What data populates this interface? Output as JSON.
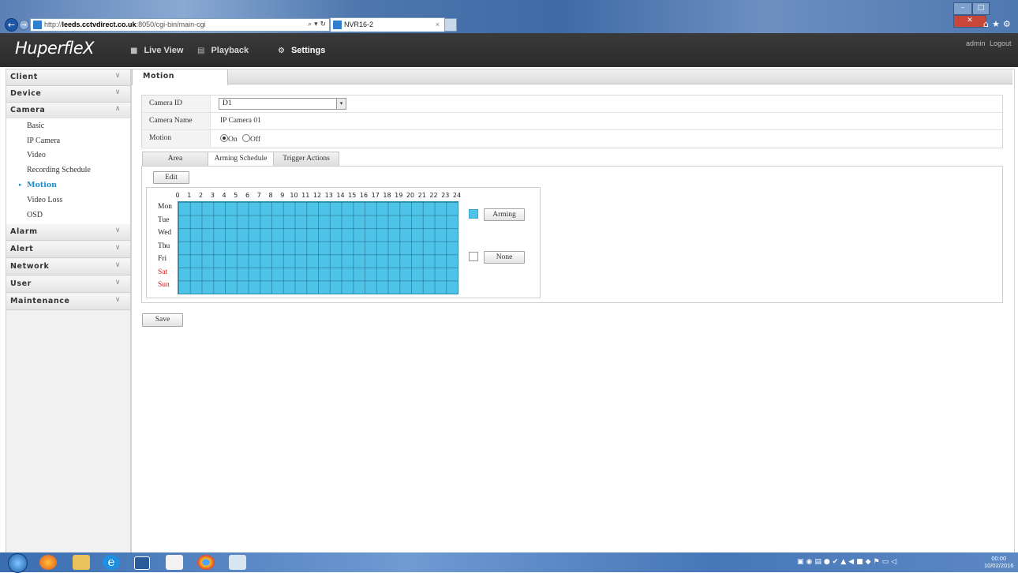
{
  "browser": {
    "address_scheme": "http://",
    "address_host": "leeds.cctvdirect.co.uk",
    "address_path": ":8050/cgi-bin/main-cgi",
    "address_controls": "⌕ ▾ ↻",
    "tab_title": "NVR16-2",
    "tab_close": "×",
    "back_icon": "←",
    "forward_icon": "→",
    "win_min": "–",
    "win_max": "□",
    "win_close": "✕",
    "toolbar_icons": "⌂★⚙"
  },
  "header": {
    "logo_main": "Huperfle",
    "logo_x": "X",
    "nav": [
      {
        "label": "Live View",
        "icon": "■"
      },
      {
        "label": "Playback",
        "icon": "▤"
      },
      {
        "label": "Settings",
        "icon": "⚙"
      }
    ],
    "user": "admin",
    "logout": "Logout"
  },
  "sidebar": {
    "sections": [
      {
        "label": "Client",
        "chev": "∨"
      },
      {
        "label": "Device",
        "chev": "∨"
      },
      {
        "label": "Camera",
        "chev": "∧"
      },
      {
        "label": "Alarm",
        "chev": "∨"
      },
      {
        "label": "Alert",
        "chev": "∨"
      },
      {
        "label": "Network",
        "chev": "∨"
      },
      {
        "label": "User",
        "chev": "∨"
      },
      {
        "label": "Maintenance",
        "chev": "∨"
      }
    ],
    "camera_items": [
      "Basic",
      "IP Camera",
      "Video",
      "Recording Schedule",
      "Motion",
      "Video Loss",
      "OSD"
    ],
    "active_arrow": "▸"
  },
  "main": {
    "tab_label": "Motion",
    "camera_id_label": "Camera ID",
    "camera_id_value": "D1",
    "dropdown_icon": "▾",
    "camera_name_label": "Camera Name",
    "camera_name_value": "IP Camera 01",
    "motion_label": "Motion",
    "motion_on": "On",
    "motion_off": "Off",
    "motion_selected": "On",
    "subtabs": [
      "Area",
      "Arming Schedule",
      "Trigger Actions"
    ],
    "active_subtab": "Arming Schedule",
    "edit_label": "Edit",
    "hours": [
      "0",
      "1",
      "2",
      "3",
      "4",
      "5",
      "6",
      "7",
      "8",
      "9",
      "10",
      "11",
      "12",
      "13",
      "14",
      "15",
      "16",
      "17",
      "18",
      "19",
      "20",
      "21",
      "22",
      "23",
      "24"
    ],
    "days": [
      "Mon",
      "Tue",
      "Wed",
      "Thu",
      "Fri",
      "Sat",
      "Sun"
    ],
    "arming_label": "Arming",
    "none_label": "None",
    "arming_color": "#4ec3e8",
    "weekend_color": "#d21a1a",
    "save_label": "Save"
  },
  "taskbar": {
    "tray_icons": "▣◉▤●✔▲◀■◆⚑▭◁",
    "time": "00:00",
    "date": "10/02/2016"
  }
}
